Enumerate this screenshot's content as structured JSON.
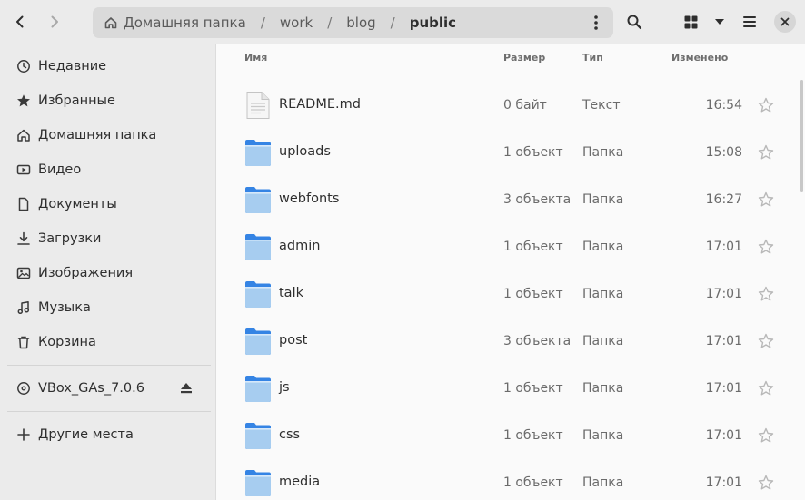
{
  "header": {
    "back_icon": "chevron-left-icon",
    "forward_icon": "chevron-right-icon",
    "path": {
      "home": "Домашняя папка",
      "segments": [
        "work",
        "blog"
      ],
      "current": "public",
      "separator": "/"
    },
    "search_icon": "search-icon",
    "view_icon": "grid-view-icon",
    "view_options_icon": "chevron-down-icon",
    "menu_icon": "hamburger-icon",
    "close_icon": "close-icon"
  },
  "sidebar": {
    "items": [
      {
        "label": "Недавние",
        "icon": "clock-icon"
      },
      {
        "label": "Избранные",
        "icon": "star-icon"
      },
      {
        "label": "Домашняя папка",
        "icon": "home-icon"
      },
      {
        "label": "Видео",
        "icon": "video-icon"
      },
      {
        "label": "Документы",
        "icon": "document-icon"
      },
      {
        "label": "Загрузки",
        "icon": "download-icon"
      },
      {
        "label": "Изображения",
        "icon": "image-icon"
      },
      {
        "label": "Музыка",
        "icon": "music-icon"
      },
      {
        "label": "Корзина",
        "icon": "trash-icon"
      }
    ],
    "devices": [
      {
        "label": "VBox_GAs_7.0.6",
        "icon": "disc-icon",
        "eject_icon": "eject-icon"
      }
    ],
    "other": {
      "label": "Другие места",
      "icon": "plus-icon"
    }
  },
  "columns": {
    "name": "Имя",
    "size": "Размер",
    "type": "Тип",
    "modified": "Изменено"
  },
  "files": [
    {
      "name": "README.md",
      "size": "0 байт",
      "type": "Текст",
      "modified": "16:54",
      "kind": "text"
    },
    {
      "name": "uploads",
      "size": "1 объект",
      "type": "Папка",
      "modified": "15:08",
      "kind": "folder"
    },
    {
      "name": "webfonts",
      "size": "3 объекта",
      "type": "Папка",
      "modified": "16:27",
      "kind": "folder"
    },
    {
      "name": "admin",
      "size": "1 объект",
      "type": "Папка",
      "modified": "17:01",
      "kind": "folder"
    },
    {
      "name": "talk",
      "size": "1 объект",
      "type": "Папка",
      "modified": "17:01",
      "kind": "folder"
    },
    {
      "name": "post",
      "size": "3 объекта",
      "type": "Папка",
      "modified": "17:01",
      "kind": "folder"
    },
    {
      "name": "js",
      "size": "1 объект",
      "type": "Папка",
      "modified": "17:01",
      "kind": "folder"
    },
    {
      "name": "css",
      "size": "1 объект",
      "type": "Папка",
      "modified": "17:01",
      "kind": "folder"
    },
    {
      "name": "media",
      "size": "1 объект",
      "type": "Папка",
      "modified": "17:01",
      "kind": "folder"
    }
  ],
  "colors": {
    "folder_body": "#a7cdf0",
    "folder_tab": "#3584e4",
    "header_bg": "#ebebeb",
    "sidebar_bg": "#ebebeb",
    "main_bg": "#fafafa"
  }
}
